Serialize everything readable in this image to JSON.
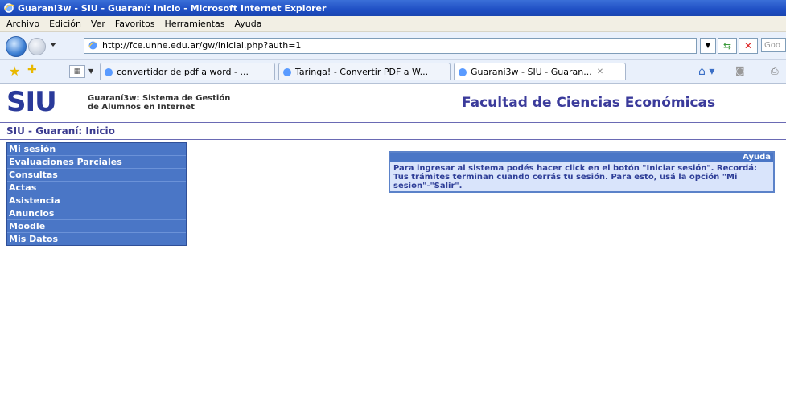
{
  "window": {
    "title": "Guarani3w - SIU - Guaraní: Inicio - Microsoft Internet Explorer"
  },
  "menubar": {
    "items": [
      "Archivo",
      "Edición",
      "Ver",
      "Favoritos",
      "Herramientas",
      "Ayuda"
    ]
  },
  "address": {
    "url": "http://fce.unne.edu.ar/gw/inicial.php?auth=1",
    "search_placeholder": "Goo"
  },
  "tabs": [
    {
      "label": "convertidor de pdf a word - ..."
    },
    {
      "label": "Taringa! - Convertir PDF a W..."
    },
    {
      "label": "Guarani3w - SIU - Guaran..."
    }
  ],
  "header": {
    "logo": "SIU",
    "subtitle_line1": "Guaraní3w: Sistema de Gestión",
    "subtitle_line2": "de Alumnos en Internet",
    "faculty": "Facultad de Ciencias Económicas"
  },
  "breadcrumb": "SIU - Guaraní: Inicio",
  "sidebar": {
    "items": [
      "Mi sesión",
      "Evaluaciones Parciales",
      "Consultas",
      "Actas",
      "Asistencia",
      "Anuncios",
      "Moodle",
      "Mis Datos"
    ]
  },
  "help": {
    "title": "Ayuda",
    "text": "Para ingresar al sistema podés hacer click en el botón \"Iniciar sesión\". Recordá: Tus trámites terminan cuando cerrás tu sesión. Para esto, usá la opción \"Mi sesion\"-\"Salir\"."
  },
  "colors": {
    "menu_bg": "#4a76c6",
    "help_bg": "#d9e4fb",
    "faculty_text": "#3b3b9b"
  }
}
